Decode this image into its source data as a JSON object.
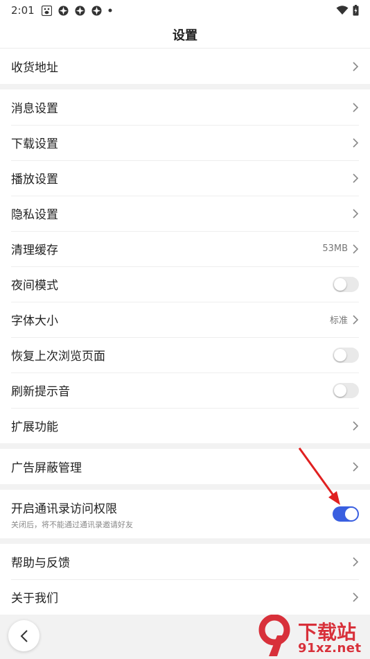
{
  "status_bar": {
    "time": "2:01"
  },
  "header": {
    "title": "设置"
  },
  "groups": [
    {
      "items": [
        {
          "label": "收货地址",
          "type": "link"
        }
      ]
    },
    {
      "items": [
        {
          "label": "消息设置",
          "type": "link"
        },
        {
          "label": "下载设置",
          "type": "link"
        },
        {
          "label": "播放设置",
          "type": "link"
        },
        {
          "label": "隐私设置",
          "type": "link"
        },
        {
          "label": "清理缓存",
          "type": "link",
          "value": "53MB"
        },
        {
          "label": "夜间模式",
          "type": "toggle",
          "on": false
        },
        {
          "label": "字体大小",
          "type": "link",
          "value": "标准"
        },
        {
          "label": "恢复上次浏览页面",
          "type": "toggle",
          "on": false
        },
        {
          "label": "刷新提示音",
          "type": "toggle",
          "on": false
        },
        {
          "label": "扩展功能",
          "type": "link"
        }
      ]
    },
    {
      "items": [
        {
          "label": "广告屏蔽管理",
          "type": "link"
        }
      ]
    },
    {
      "items": [
        {
          "label": "开启通讯录访问权限",
          "sublabel": "关闭后，将不能通过通讯录邀请好友",
          "type": "toggle",
          "on": true
        }
      ]
    },
    {
      "items": [
        {
          "label": "帮助与反馈",
          "type": "link"
        },
        {
          "label": "关于我们",
          "type": "link"
        }
      ]
    }
  ],
  "watermark": {
    "line1": "下载站",
    "line2": "91xz.net",
    "logo": "9"
  },
  "colors": {
    "accent": "#3a5fe0",
    "annotation_arrow": "#e02020",
    "watermark": "#d8303a"
  }
}
